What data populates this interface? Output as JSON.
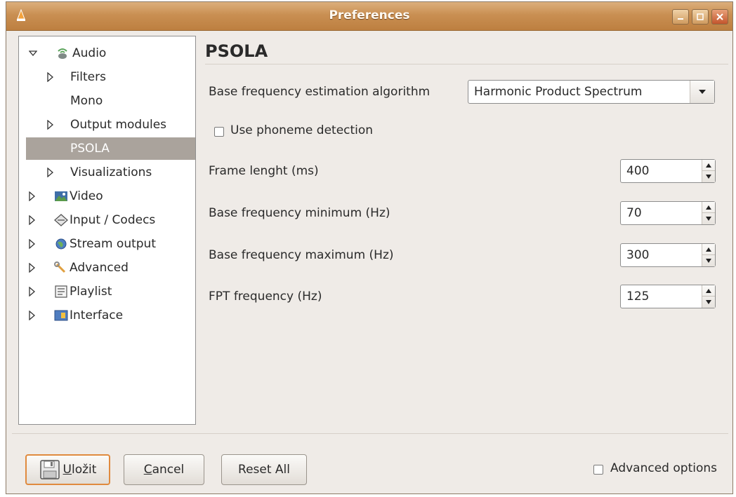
{
  "window": {
    "title": "Preferences"
  },
  "tree": {
    "items": [
      {
        "label": "Audio",
        "icon": "audio-icon",
        "expanded": true
      },
      {
        "label": "Filters",
        "collapsed": true
      },
      {
        "label": "Mono"
      },
      {
        "label": "Output modules",
        "collapsed": true
      },
      {
        "label": "PSOLA",
        "selected": true
      },
      {
        "label": "Visualizations",
        "collapsed": true
      },
      {
        "label": "Video",
        "icon": "video-icon"
      },
      {
        "label": "Input / Codecs",
        "icon": "input-codecs-icon"
      },
      {
        "label": "Stream output",
        "icon": "stream-output-icon"
      },
      {
        "label": "Advanced",
        "icon": "advanced-icon"
      },
      {
        "label": "Playlist",
        "icon": "playlist-icon"
      },
      {
        "label": "Interface",
        "icon": "interface-icon"
      }
    ]
  },
  "panel": {
    "title": "PSOLA",
    "algorithm": {
      "label": "Base frequency estimation algorithm",
      "value": "Harmonic Product Spectrum"
    },
    "phoneme": {
      "label": "Use phoneme detection",
      "checked": false
    },
    "frame_length": {
      "label": "Frame lenght (ms)",
      "value": "400"
    },
    "freq_min": {
      "label": "Base frequency minimum (Hz)",
      "value": "70"
    },
    "freq_max": {
      "label": "Base frequency maximum (Hz)",
      "value": "300"
    },
    "fpt": {
      "label": "FPT frequency (Hz)",
      "value": "125"
    }
  },
  "buttons": {
    "save_first": "U",
    "save_rest": "ložit",
    "cancel_first": "C",
    "cancel_rest": "ancel",
    "reset": "Reset All"
  },
  "advanced_options": {
    "label": "Advanced options",
    "checked": false
  },
  "colors": {
    "titlebar": "#c98f52",
    "selection": "#aaa39c",
    "default_button_border": "#e08a3e"
  }
}
